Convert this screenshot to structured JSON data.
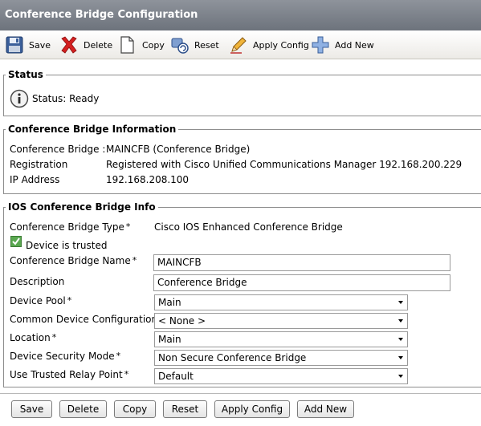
{
  "header": {
    "title": "Conference Bridge Configuration"
  },
  "toolbar": {
    "save": "Save",
    "delete": "Delete",
    "copy": "Copy",
    "reset": "Reset",
    "apply_config": "Apply Config",
    "add_new": "Add New"
  },
  "status": {
    "legend": "Status",
    "text": "Status: Ready"
  },
  "cb_info": {
    "legend": "Conference Bridge Information",
    "rows": [
      {
        "label": "Conference Bridge :",
        "value": "MAINCFB (Conference Bridge)"
      },
      {
        "label": "Registration",
        "value": "Registered with Cisco Unified Communications Manager 192.168.200.229"
      },
      {
        "label": "IP Address",
        "value": "192.168.208.100"
      }
    ]
  },
  "ios_info": {
    "legend": "IOS Conference Bridge Info",
    "required_mark": "*",
    "type_label": "Conference Bridge Type",
    "type_value": "Cisco IOS Enhanced Conference Bridge",
    "trusted_label": "Device is trusted",
    "name_label": "Conference Bridge Name",
    "name_value": "MAINCFB",
    "description_label": "Description",
    "description_value": "Conference Bridge",
    "device_pool_label": "Device Pool",
    "device_pool_value": "Main",
    "common_config_label": "Common Device Configuration",
    "common_config_value": "< None >",
    "location_label": "Location",
    "location_value": "Main",
    "security_label": "Device Security Mode",
    "security_value": "Non Secure Conference Bridge",
    "relay_label": "Use Trusted Relay Point",
    "relay_value": "Default"
  },
  "buttons": {
    "save": "Save",
    "delete": "Delete",
    "copy": "Copy",
    "reset": "Reset",
    "apply_config": "Apply Config",
    "add_new": "Add New"
  },
  "colors": {
    "title_bar": "#7a8089",
    "delete_icon": "#d42020",
    "checkbox": "#5aa850"
  }
}
